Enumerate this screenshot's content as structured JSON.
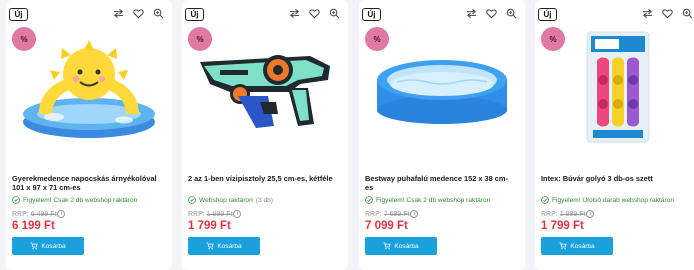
{
  "labels": {
    "new_badge": "Új",
    "sale_badge": "%",
    "cart_button": "Kosárba",
    "rrp_label": "RRP:",
    "info": "i"
  },
  "colors": {
    "price": "#e0353b",
    "button": "#1aa0dc",
    "sale_badge": "#e07aa4",
    "stock": "#2e8b3c"
  },
  "products": [
    {
      "title": "Gyerekmedence napocskás árnyékolóval 101 x 97 x 71 cm-es",
      "stock": "Figyelem! Csak 2 db webshop raktáron",
      "stock_note": "",
      "rrp": "6 499 Ft",
      "price": "6 199 Ft",
      "image": "sun-shade-kiddie-pool"
    },
    {
      "title": "2 az 1-ben vízipisztoly 25,5 cm-es, kétféle",
      "stock": "Webshop raktáron",
      "stock_note": "(3 db)",
      "rrp": "1 999 Ft",
      "price": "1 799 Ft",
      "image": "water-gun"
    },
    {
      "title": "Bestway puhafalú medence 152 x 38 cm-es",
      "stock": "Figyelem! Csak 2 db webshop raktáron",
      "stock_note": "",
      "rrp": "7 699 Ft",
      "price": "7 099 Ft",
      "image": "inflatable-pool"
    },
    {
      "title": "Intex: Búvár golyó 3 db-os szett",
      "stock": "Figyelem! Utolsó darab webshop raktáron",
      "stock_note": "",
      "rrp": "1 999 Ft",
      "price": "1 799 Ft",
      "image": "dive-balls-set"
    }
  ]
}
